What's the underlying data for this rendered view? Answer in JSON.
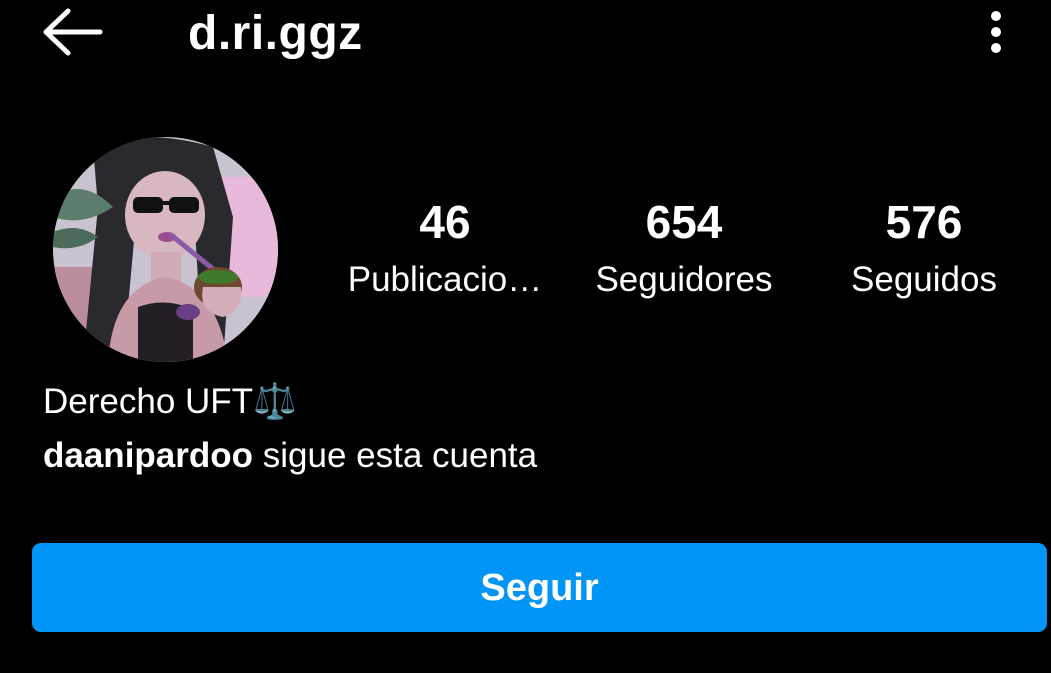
{
  "header": {
    "back_icon": "back-arrow-icon",
    "username": "d.ri.ggz",
    "more_icon": "more-vertical-icon"
  },
  "profile": {
    "avatar_alt": "avatar",
    "stats": [
      {
        "count": "46",
        "label": "Publicacio…"
      },
      {
        "count": "654",
        "label": "Seguidores"
      },
      {
        "count": "576",
        "label": "Seguidos"
      }
    ],
    "bio": "Derecho UFT⚖️",
    "followed_by": {
      "user": "daanipardoo",
      "text": " sigue esta cuenta"
    }
  },
  "actions": {
    "follow_label": "Seguir"
  },
  "colors": {
    "background": "#000000",
    "text": "#ffffff",
    "follow_button": "#0095f6"
  }
}
